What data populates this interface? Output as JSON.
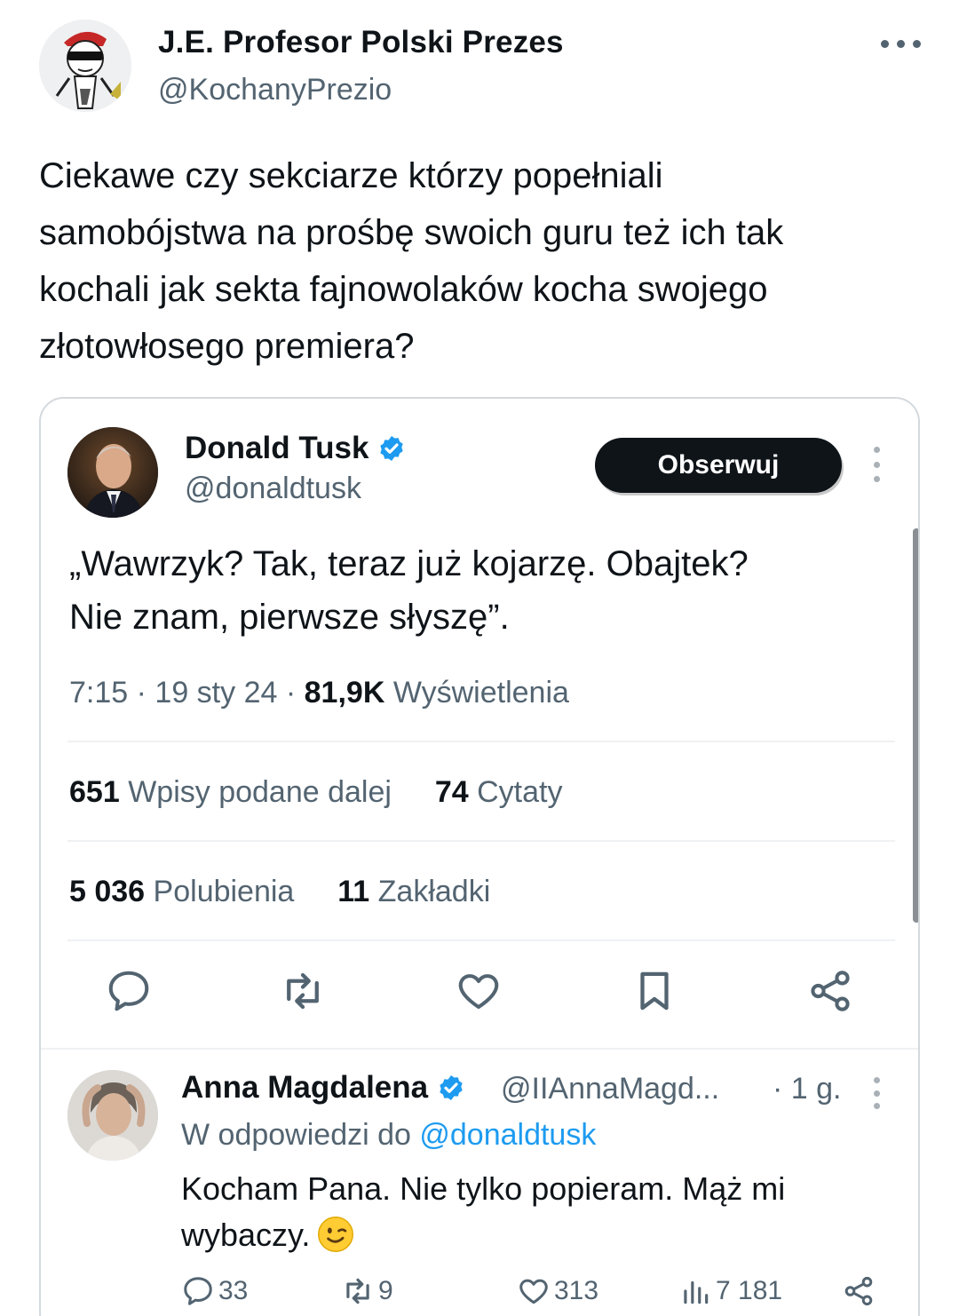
{
  "post": {
    "author_name": "J.E. Profesor Polski Prezes",
    "author_handle": "@KochanyPrezio",
    "text": "Ciekawe czy sekciarze którzy popełniali\nsamobójstwa na prośbę swoich guru też ich tak\nkochali jak sekta fajnowolaków kocha swojego\nzłotowłosego premiera?"
  },
  "quoted": {
    "name": "Donald Tusk",
    "handle": "@donaldtusk",
    "follow_label": "Obserwuj",
    "text": "„Wawrzyk? Tak, teraz już kojarzę. Obajtek?\nNie znam, pierwsze słyszę”.",
    "time": "7:15",
    "date": "19 sty 24",
    "views_count": "81,9K",
    "views_label": "Wyświetlenia",
    "reposts_count": "651",
    "reposts_label": "Wpisy podane dalej",
    "quotes_count": "74",
    "quotes_label": "Cytaty",
    "likes_count": "5 036",
    "likes_label": "Polubienia",
    "bookmarks_count": "11",
    "bookmarks_label": "Zakładki"
  },
  "reply": {
    "name": "Anna Magdalena",
    "handle": "@IIAnnaMagd...",
    "time": "· 1 g.",
    "reply_prefix": "W odpowiedzi do",
    "reply_to": "@donaldtusk",
    "text": "Kocham Pana. Nie tylko popieram. Mąż mi\nwybaczy.",
    "replies": "33",
    "reposts": "9",
    "likes": "313",
    "views": "7 181"
  },
  "icons": {
    "more_main": "more-horizontal-icon",
    "verified": "verified-badge-icon",
    "reply": "reply-icon",
    "repost": "repost-icon",
    "like": "heart-icon",
    "bookmark": "bookmark-icon",
    "share": "share-icon",
    "views": "views-chart-icon",
    "emoji": "winking-face-emoji"
  },
  "colors": {
    "text": "#0f1419",
    "secondary": "#536471",
    "link": "#1d9bf0",
    "verified": "#1d9bf0",
    "button_bg": "#0f1419"
  }
}
